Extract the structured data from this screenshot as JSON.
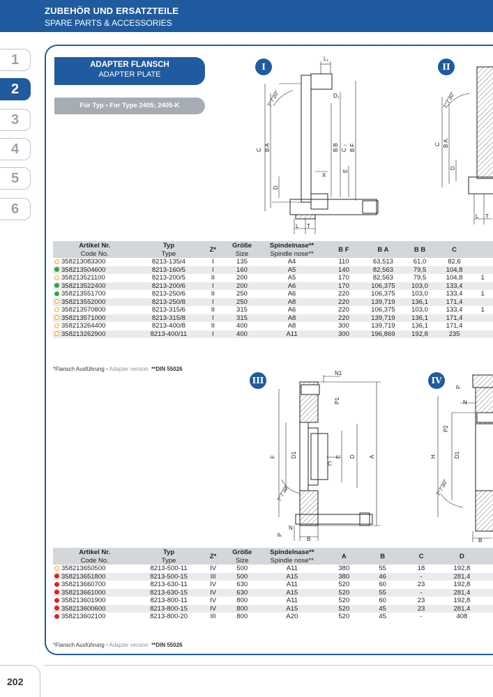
{
  "header": {
    "title_de": "ZUBEHÖR UND ERSATZTEILE",
    "title_en": "SPARE PARTS & ACCESSORIES"
  },
  "sidebar": {
    "tabs": [
      "1",
      "2",
      "3",
      "4",
      "5",
      "6"
    ],
    "active": "2"
  },
  "section": {
    "title_de": "ADAPTER FLANSCH",
    "title_en": "ADAPTER PLATE",
    "type_label": "Für Typ • For Type 2405; 2405-K"
  },
  "drawings": {
    "badges": [
      "I",
      "II",
      "III",
      "IV"
    ],
    "labels_I": {
      "l1": "L₁",
      "d1": "D₁",
      "c": "C",
      "ba": "B A",
      "bb": "B B",
      "c2": "C ₂",
      "bf": "B F",
      "d": "D",
      "x": "X",
      "e": "E",
      "l": "L",
      "t": "T",
      "angle": "7°7'30\""
    },
    "labels_II": {
      "c": "C",
      "ba": "B A",
      "d": "D",
      "l": "L",
      "t": "T",
      "angle": "7°7'30\""
    },
    "labels_III": {
      "n1": "N1",
      "p1": "P1",
      "f": "F",
      "d1": "D1",
      "c": "C",
      "e": "E",
      "d": "D",
      "a": "A",
      "angle": "7°7'30\"",
      "p": "P",
      "n": "N",
      "b": "B"
    },
    "labels_IV": {
      "p": "P",
      "n": "N",
      "p2": "P2",
      "h": "H",
      "d1": "D1",
      "angle": "7°7'30\"",
      "b": "B"
    }
  },
  "table1": {
    "headers": [
      "Artikel Nr.",
      "Typ",
      "Z*",
      "Größe",
      "Spindelnase**",
      "B F",
      "B A",
      "B B",
      "C"
    ],
    "subheaders": [
      "Code No.",
      "Type",
      "Size",
      "Spindle nose**"
    ],
    "rows": [
      {
        "dot": "ring",
        "code": "358213083300",
        "typ": "8213-135/4",
        "z": "I",
        "size": "135",
        "nose": "A4",
        "bf": "110",
        "ba": "63,513",
        "bb": "61,0",
        "c": "82,6",
        "extra": ""
      },
      {
        "dot": "green",
        "code": "358213504600",
        "typ": "8213-160/5",
        "z": "I",
        "size": "160",
        "nose": "A5",
        "bf": "140",
        "ba": "82,563",
        "bb": "79,5",
        "c": "104,8",
        "extra": ""
      },
      {
        "dot": "ring",
        "code": "358213521100",
        "typ": "8213-200/5",
        "z": "II",
        "size": "200",
        "nose": "A5",
        "bf": "170",
        "ba": "82,563",
        "bb": "79,5",
        "c": "104,8",
        "extra": "1"
      },
      {
        "dot": "green",
        "code": "358213522400",
        "typ": "8213-200/6",
        "z": "I",
        "size": "200",
        "nose": "A6",
        "bf": "170",
        "ba": "106,375",
        "bb": "103,0",
        "c": "133,4",
        "extra": ""
      },
      {
        "dot": "green",
        "code": "358213551700",
        "typ": "8213-250/6",
        "z": "II",
        "size": "250",
        "nose": "A6",
        "bf": "220",
        "ba": "106,375",
        "bb": "103,0",
        "c": "133,4",
        "extra": "1"
      },
      {
        "dot": "ring",
        "code": "358213552000",
        "typ": "8213-250/8",
        "z": "I",
        "size": "250",
        "nose": "A8",
        "bf": "220",
        "ba": "139,719",
        "bb": "136,1",
        "c": "171,4",
        "extra": ""
      },
      {
        "dot": "ring",
        "code": "358213570800",
        "typ": "8213-315/6",
        "z": "II",
        "size": "315",
        "nose": "A6",
        "bf": "220",
        "ba": "106,375",
        "bb": "103,0",
        "c": "133,4",
        "extra": "1"
      },
      {
        "dot": "ring",
        "code": "358213571000",
        "typ": "8213-315/8",
        "z": "I",
        "size": "315",
        "nose": "A8",
        "bf": "220",
        "ba": "139,719",
        "bb": "136,1",
        "c": "171,4",
        "extra": ""
      },
      {
        "dot": "ring",
        "code": "358213264400",
        "typ": "8213-400/8",
        "z": "II",
        "size": "400",
        "nose": "A8",
        "bf": "300",
        "ba": "139,719",
        "bb": "136,1",
        "c": "171,4",
        "extra": ""
      },
      {
        "dot": "ring",
        "code": "358213262900",
        "typ": "8213-400/11",
        "z": "I",
        "size": "400",
        "nose": "A11",
        "bf": "300",
        "ba": "196,869",
        "bb": "192,8",
        "c": "235",
        "extra": ""
      }
    ]
  },
  "table2": {
    "headers": [
      "Artikel Nr.",
      "Typ",
      "Z*",
      "Größe",
      "Spindelnase**",
      "A",
      "B",
      "C",
      "D"
    ],
    "subheaders": [
      "Code No.",
      "Type",
      "Size",
      "Spindle nose**"
    ],
    "rows": [
      {
        "dot": "ring",
        "code": "358213650500",
        "typ": "8213-500-11",
        "z": "IV",
        "size": "500",
        "nose": "A11",
        "a": "380",
        "b": "55",
        "c": "18",
        "d": "192,8"
      },
      {
        "dot": "red",
        "code": "358213651800",
        "typ": "8213-500-15",
        "z": "III",
        "size": "500",
        "nose": "A15",
        "a": "380",
        "b": "46",
        "c": "-",
        "d": "281,4"
      },
      {
        "dot": "red",
        "code": "358213660700",
        "typ": "8213-630-11",
        "z": "IV",
        "size": "630",
        "nose": "A11",
        "a": "520",
        "b": "60",
        "c": "23",
        "d": "192,8"
      },
      {
        "dot": "red",
        "code": "358213661000",
        "typ": "8213-630-15",
        "z": "IV",
        "size": "630",
        "nose": "A15",
        "a": "520",
        "b": "55",
        "c": "-",
        "d": "281,4"
      },
      {
        "dot": "red",
        "code": "358213601900",
        "typ": "8213-800-11",
        "z": "IV",
        "size": "800",
        "nose": "A11",
        "a": "520",
        "b": "60",
        "c": "23",
        "d": "192,8"
      },
      {
        "dot": "red",
        "code": "358213600600",
        "typ": "8213-800-15",
        "z": "IV",
        "size": "800",
        "nose": "A15",
        "a": "520",
        "b": "45",
        "c": "23",
        "d": "281,4"
      },
      {
        "dot": "red",
        "code": "358213602100",
        "typ": "8213-800-20",
        "z": "III",
        "size": "800",
        "nose": "A20",
        "a": "520",
        "b": "45",
        "c": "-",
        "d": "408"
      }
    ]
  },
  "footnote": {
    "star": "*Flansch Ausführung",
    "sep": " • ",
    "star_en": "Adapter version",
    "din": "**DIN 55026"
  },
  "page_number": "202",
  "colors": {
    "brand_blue": "#1f5b9e",
    "header_gray": "#d3d6da",
    "row_gray": "#e9ebee",
    "ring_orange": "#f0a21a",
    "green": "#3aa148",
    "red": "#e02323"
  }
}
